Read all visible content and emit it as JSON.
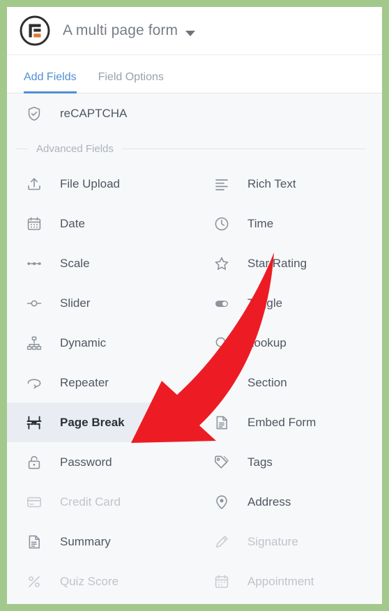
{
  "window": {
    "border_color": "#a3c88c",
    "background": "#f7f8fa"
  },
  "header": {
    "logo_name": "wpforms-logo-icon",
    "logo_colors": {
      "dark": "#2e2e2e",
      "accent": "#e27730"
    },
    "form_title": "A multi page form",
    "dropdown_icon": "chevron-down-icon"
  },
  "tabs": {
    "items": [
      {
        "label": "Add Fields",
        "active": true
      },
      {
        "label": "Field Options",
        "active": false
      }
    ],
    "active_color": "#4e8fd6",
    "inactive_color": "#9aa1a9"
  },
  "standard_tail": {
    "items": [
      {
        "label": "reCAPTCHA",
        "icon": "shield-check-icon",
        "disabled": false,
        "selected": false
      }
    ]
  },
  "section_divider": {
    "label": "Advanced Fields"
  },
  "advanced_fields": {
    "rows": [
      [
        {
          "label": "File Upload",
          "icon": "upload-icon",
          "disabled": false,
          "selected": false
        },
        {
          "label": "Rich Text",
          "icon": "rich-text-icon",
          "disabled": false,
          "selected": false
        }
      ],
      [
        {
          "label": "Date",
          "icon": "calendar-icon",
          "disabled": false,
          "selected": false
        },
        {
          "label": "Time",
          "icon": "clock-icon",
          "disabled": false,
          "selected": false
        }
      ],
      [
        {
          "label": "Scale",
          "icon": "scale-icon",
          "disabled": false,
          "selected": false
        },
        {
          "label": "Star Rating",
          "icon": "star-icon",
          "disabled": false,
          "selected": false
        }
      ],
      [
        {
          "label": "Slider",
          "icon": "slider-icon",
          "disabled": false,
          "selected": false
        },
        {
          "label": "Toggle",
          "icon": "toggle-icon",
          "disabled": false,
          "selected": false
        }
      ],
      [
        {
          "label": "Dynamic",
          "icon": "sitemap-icon",
          "disabled": false,
          "selected": false
        },
        {
          "label": "Lookup",
          "icon": "lookup-icon",
          "disabled": false,
          "selected": false
        }
      ],
      [
        {
          "label": "Repeater",
          "icon": "repeat-icon",
          "disabled": false,
          "selected": false
        },
        {
          "label": "Section",
          "icon": "heading-h-icon",
          "disabled": false,
          "selected": false
        }
      ],
      [
        {
          "label": "Page Break",
          "icon": "page-break-icon",
          "disabled": false,
          "selected": true
        },
        {
          "label": "Embed Form",
          "icon": "embed-form-icon",
          "disabled": false,
          "selected": false
        }
      ],
      [
        {
          "label": "Password",
          "icon": "lock-icon",
          "disabled": false,
          "selected": false
        },
        {
          "label": "Tags",
          "icon": "tags-icon",
          "disabled": false,
          "selected": false
        }
      ],
      [
        {
          "label": "Credit Card",
          "icon": "credit-card-icon",
          "disabled": true,
          "selected": false
        },
        {
          "label": "Address",
          "icon": "map-pin-icon",
          "disabled": false,
          "selected": false
        }
      ],
      [
        {
          "label": "Summary",
          "icon": "summary-doc-icon",
          "disabled": false,
          "selected": false
        },
        {
          "label": "Signature",
          "icon": "pencil-icon",
          "disabled": true,
          "selected": false
        }
      ],
      [
        {
          "label": "Quiz Score",
          "icon": "percent-icon",
          "disabled": true,
          "selected": false
        },
        {
          "label": "Appointment",
          "icon": "calendar-appointment-icon",
          "disabled": true,
          "selected": false
        }
      ]
    ],
    "selected_row_accent": "#2f9130",
    "selected_row_background": "#e9edf3"
  },
  "annotation": {
    "arrow_icon": "red-curved-arrow-annotation",
    "color": "#ed1c24",
    "points_to": "Page Break"
  }
}
